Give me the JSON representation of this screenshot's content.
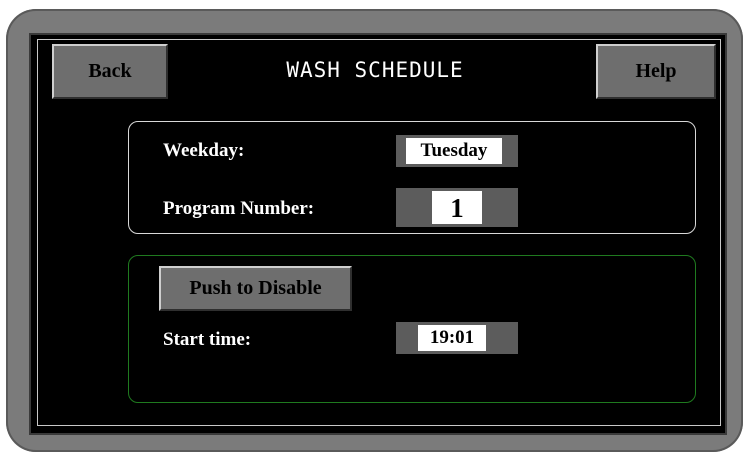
{
  "header": {
    "back_label": "Back",
    "title": "WASH SCHEDULE",
    "help_label": "Help"
  },
  "schedule": {
    "weekday_label": "Weekday:",
    "weekday_value": "Tuesday",
    "program_label": "Program Number:",
    "program_value": "1"
  },
  "timer": {
    "disable_button_label": "Push to Disable",
    "start_time_label": "Start time:",
    "start_time_value": "19:01"
  },
  "colors": {
    "background": "#000000",
    "button_gray": "#6e6e6e",
    "bezel_gray": "#7b7b7b",
    "schedule_panel_border": "#d8d8d8",
    "timer_panel_border": "#1f7a1f"
  }
}
